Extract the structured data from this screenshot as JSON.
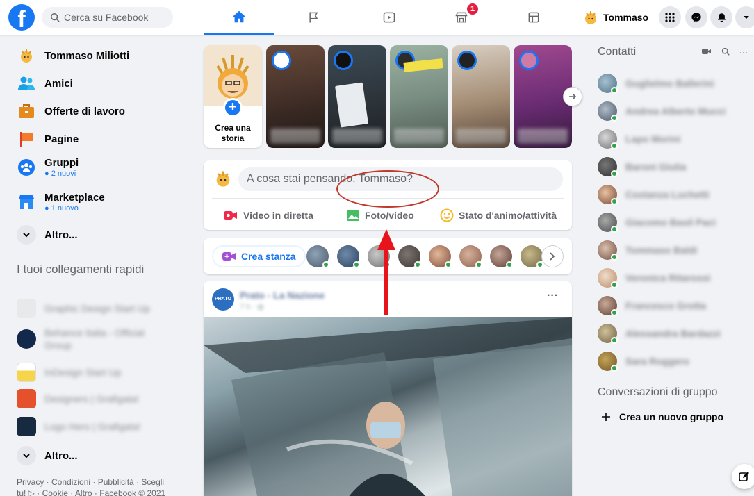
{
  "topbar": {
    "search_placeholder": "Cerca su Facebook",
    "marketplace_badge": "1",
    "profile_name": "Tommaso"
  },
  "sidebar": {
    "items": [
      {
        "label": "Tommaso Miliotti",
        "icon": "profile-avatar"
      },
      {
        "label": "Amici",
        "icon": "friends-icon"
      },
      {
        "label": "Offerte di lavoro",
        "icon": "briefcase-icon"
      },
      {
        "label": "Pagine",
        "icon": "flag-icon"
      },
      {
        "label": "Gruppi",
        "sub": "● 2 nuovi",
        "icon": "groups-icon"
      },
      {
        "label": "Marketplace",
        "sub": "● 1 nuovo",
        "icon": "shop-icon"
      },
      {
        "label": "Altro...",
        "icon": "chevron-down-icon"
      }
    ],
    "shortcuts_title": "I tuoi collegamenti rapidi",
    "shortcuts": [
      {
        "label": "Graphic Design Start Up",
        "color": "#e8e9eb"
      },
      {
        "label": "Behance Italia - Official Group",
        "color": "#13294b"
      },
      {
        "label": "InDesign Start Up",
        "color": "#f6d54b"
      },
      {
        "label": "Designers | Grafigata!",
        "color": "#e6512d"
      },
      {
        "label": "Logo Hero | Grafigata!",
        "color": "#172a3f"
      }
    ],
    "more_label": "Altro...",
    "footer": "Privacy · Condizioni · Pubblicità · Scegli tu! ▷ · Cookie · Altro · Facebook © 2021"
  },
  "stories": {
    "create_label": "Crea una storia"
  },
  "composer": {
    "placeholder": "A cosa stai pensando, Tommaso?",
    "actions": [
      {
        "label": "Video in diretta",
        "color": "#f02849"
      },
      {
        "label": "Foto/video",
        "color": "#45bd62"
      },
      {
        "label": "Stato d'animo/attività",
        "color": "#f7b928"
      }
    ]
  },
  "rooms": {
    "create_label": "Crea stanza"
  },
  "post": {
    "page_name": "Prato - La Nazione",
    "time": "7 h · ◍",
    "page_avatar_text": "PRATO"
  },
  "contacts": {
    "title": "Contatti",
    "list": [
      "Guglielmo Ballerini",
      "Andrea Alberto Mucci",
      "Lapo Morini",
      "Baroni Giulia",
      "Costanza Luchetti",
      "Giacomo Basil Paci",
      "Tommaso Baldi",
      "Veronica Ritarossi",
      "Francesco Grotta",
      "Alessandra Bardazzi",
      "Sara Roggero"
    ],
    "group_title": "Conversazioni di gruppo",
    "new_group": "Crea un nuovo gruppo"
  },
  "colors": {
    "brand": "#1877f2",
    "annotation_red": "#e8141b"
  }
}
